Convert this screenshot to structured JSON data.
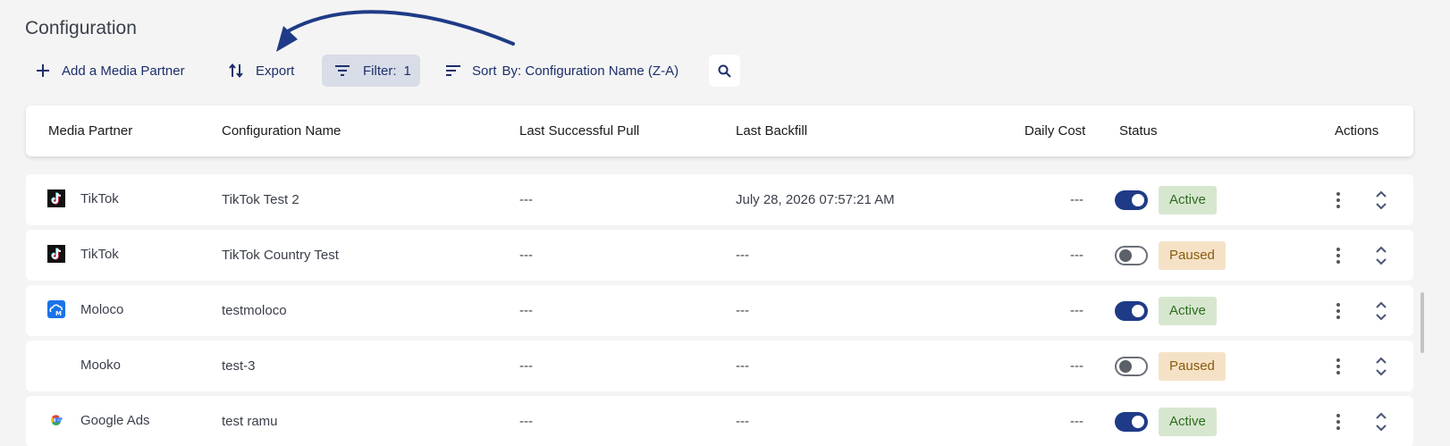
{
  "page": {
    "title": "Configuration"
  },
  "toolbar": {
    "add_label": "Add a Media Partner",
    "export_label": "Export",
    "filter_label": "Filter:",
    "filter_count": "1",
    "sort_label": "Sort",
    "sort_value": "By: Configuration Name (Z-A)"
  },
  "table": {
    "headers": {
      "media_partner": "Media Partner",
      "configuration_name": "Configuration Name",
      "last_successful_pull": "Last Successful Pull",
      "last_backfill": "Last Backfill",
      "daily_cost": "Daily Cost",
      "status": "Status",
      "actions": "Actions"
    },
    "rows": [
      {
        "partner": "TikTok",
        "logo": "tiktok-logo-icon",
        "config": "TikTok Test 2",
        "last_pull": "---",
        "last_backfill": "July 28, 2026 07:57:21 AM",
        "daily_cost": "---",
        "enabled": true,
        "status": "Active"
      },
      {
        "partner": "TikTok",
        "logo": "tiktok-logo-icon",
        "config": "TikTok Country Test",
        "last_pull": "---",
        "last_backfill": "---",
        "daily_cost": "---",
        "enabled": false,
        "status": "Paused"
      },
      {
        "partner": "Moloco",
        "logo": "moloco-logo-icon",
        "config": "testmoloco",
        "last_pull": "---",
        "last_backfill": "---",
        "daily_cost": "---",
        "enabled": true,
        "status": "Active"
      },
      {
        "partner": "Mooko",
        "logo": "",
        "config": "test-3",
        "last_pull": "---",
        "last_backfill": "---",
        "daily_cost": "---",
        "enabled": false,
        "status": "Paused"
      },
      {
        "partner": "Google Ads",
        "logo": "google-logo-icon",
        "config": "test ramu",
        "last_pull": "---",
        "last_backfill": "---",
        "daily_cost": "---",
        "enabled": true,
        "status": "Active"
      }
    ]
  },
  "colors": {
    "accent": "#1f3b87",
    "active_bg": "#d7e7cf",
    "active_text": "#2f6b1f",
    "paused_bg": "#f5e2c6",
    "paused_text": "#8a5a10",
    "annotation_arrow": "#1f3b87"
  }
}
